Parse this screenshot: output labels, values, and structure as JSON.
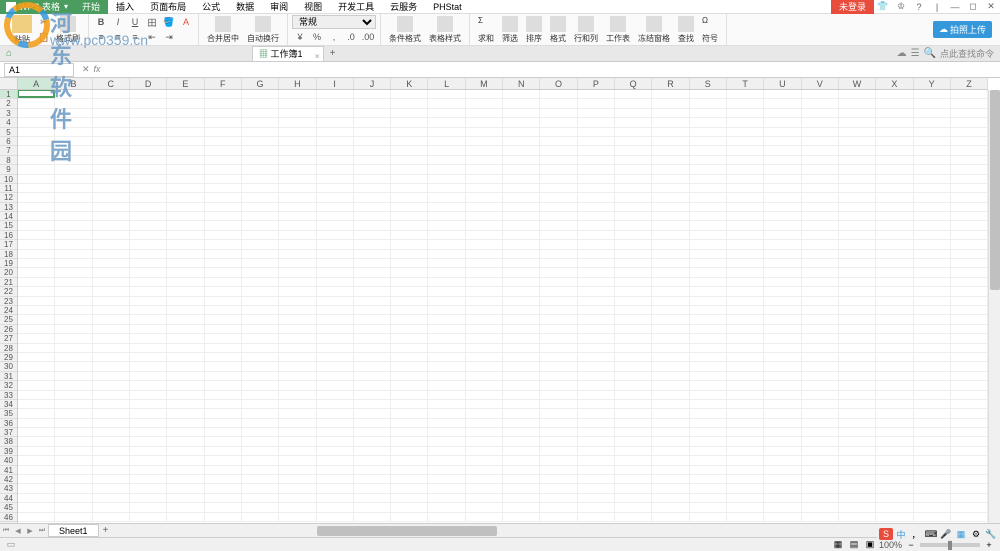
{
  "app": {
    "title": "WPS 表格",
    "login_badge": "未登录"
  },
  "menu": {
    "tabs": [
      "开始",
      "插入",
      "页面布局",
      "公式",
      "数据",
      "审阅",
      "视图",
      "开发工具",
      "云服务",
      "PHStat"
    ],
    "active_index": 0
  },
  "ribbon": {
    "paste": "粘贴",
    "format_painter": "格式刷",
    "merge_center": "合并居中",
    "auto_wrap": "自动换行",
    "number_format": "常规",
    "conditional_format": "条件格式",
    "table_style": "表格样式",
    "sum": "求和",
    "filter": "筛选",
    "sort": "排序",
    "format": "格式",
    "row_col": "行和列",
    "worksheet": "工作表",
    "freeze": "冻结窗格",
    "find": "查找",
    "symbol": "符号",
    "upload": "拍照上传"
  },
  "doc_tabs": {
    "home_tooltip": "首页",
    "tab_name": "工作簿1",
    "search_placeholder": "点此查找命令"
  },
  "formula_bar": {
    "name_box": "A1",
    "fx_label": "fx"
  },
  "grid": {
    "columns": [
      "A",
      "B",
      "C",
      "D",
      "E",
      "F",
      "G",
      "H",
      "I",
      "J",
      "K",
      "L",
      "M",
      "N",
      "O",
      "P",
      "Q",
      "R",
      "S",
      "T",
      "U",
      "V",
      "W",
      "X",
      "Y",
      "Z"
    ],
    "row_count": 46,
    "active_cell": "A1"
  },
  "sheet_tabs": {
    "active": "Sheet1"
  },
  "status": {
    "zoom": "100%",
    "ime_label": "中"
  },
  "watermark": {
    "text": "河东软件园",
    "url": "www.pc0359.cn"
  }
}
